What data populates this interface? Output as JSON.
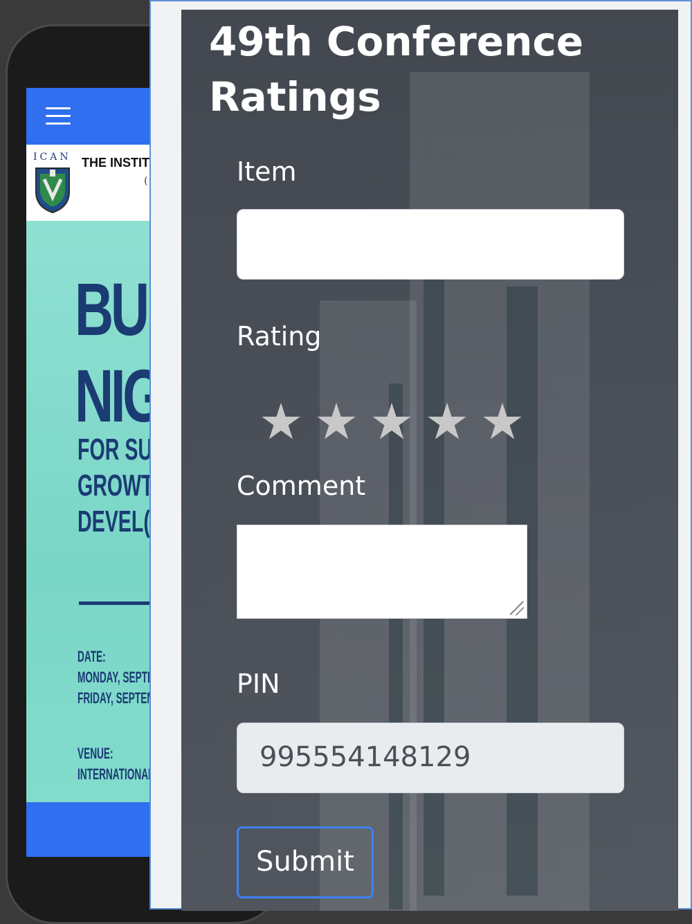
{
  "phone": {
    "logo_text": "ICAN",
    "institute_text": "THE INSTIT",
    "institute_sub": "(",
    "headline_line1": "BU",
    "headline_line2": "NIG",
    "subheadline": [
      "FOR SUS",
      "GROWT",
      "DEVEL("
    ],
    "date_label": "DATE:",
    "date_lines": [
      "MONDAY, SEPTE",
      "FRIDAY, SEPTEM"
    ],
    "venue_label": "VENUE:",
    "venue_line": "INTERNATIONAL"
  },
  "form": {
    "title": "49th Conference Ratings",
    "item_label": "Item",
    "item_value": "",
    "rating_label": "Rating",
    "rating_max": 5,
    "rating_value": 0,
    "comment_label": "Comment",
    "comment_value": "",
    "pin_label": "PIN",
    "pin_value": "995554148129",
    "submit_label": "Submit"
  },
  "colors": {
    "accent": "#3b82f6",
    "phone_bar": "#2f6ff0",
    "poster_bg": "#7fd9cd",
    "poster_text": "#1b3b73",
    "star_empty": "#c8c8c8"
  }
}
